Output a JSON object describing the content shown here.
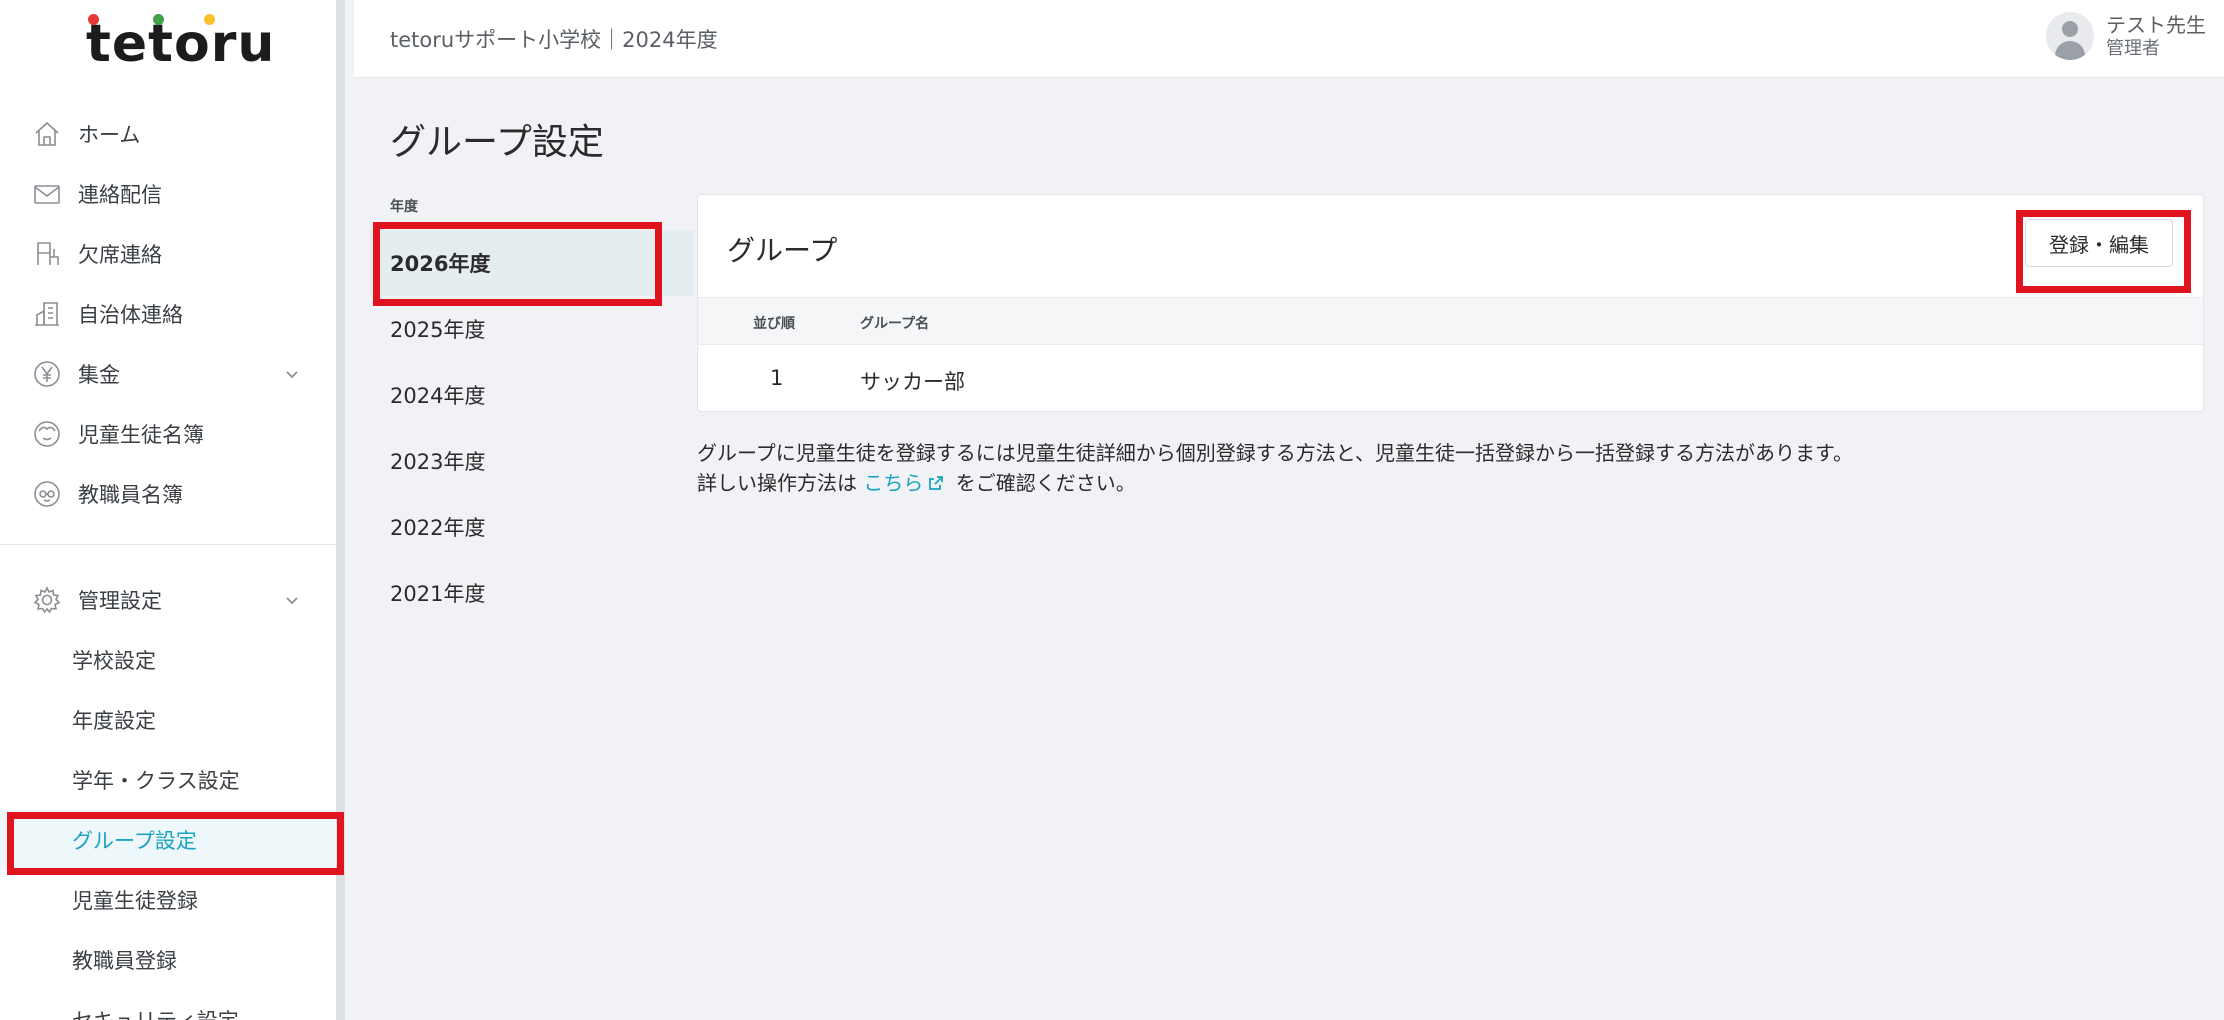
{
  "logo": {
    "text": "tetoru",
    "dot_colors": [
      "#e53935",
      "#43a047",
      "#fbc02d"
    ]
  },
  "header": {
    "title": "tetoruサポート小学校｜2024年度"
  },
  "user": {
    "name": "テスト先生",
    "role": "管理者"
  },
  "sidebar": {
    "items": [
      {
        "label": "ホーム",
        "icon": "home-icon"
      },
      {
        "label": "連絡配信",
        "icon": "mail-icon"
      },
      {
        "label": "欠席連絡",
        "icon": "desk-chair-icon"
      },
      {
        "label": "自治体連絡",
        "icon": "building-icon"
      },
      {
        "label": "集金",
        "icon": "yen-icon"
      },
      {
        "label": "児童生徒名簿",
        "icon": "child-face-icon"
      },
      {
        "label": "教職員名簿",
        "icon": "teacher-face-icon"
      }
    ],
    "admin": {
      "label": "管理設定",
      "icon": "gear-icon",
      "sub_items": [
        {
          "label": "学校設定"
        },
        {
          "label": "年度設定"
        },
        {
          "label": "学年・クラス設定"
        },
        {
          "label": "グループ設定",
          "active": true
        },
        {
          "label": "児童生徒登録"
        },
        {
          "label": "教職員登録"
        },
        {
          "label": "セキュリティ設定"
        }
      ]
    }
  },
  "main": {
    "title": "グループ設定",
    "year_heading": "年度",
    "years": [
      {
        "label": "2026年度",
        "active": true
      },
      {
        "label": "2025年度"
      },
      {
        "label": "2024年度"
      },
      {
        "label": "2023年度"
      },
      {
        "label": "2022年度"
      },
      {
        "label": "2021年度"
      }
    ],
    "panel": {
      "title": "グループ",
      "edit_button": "登録・編集",
      "columns": [
        "並び順",
        "グループ名"
      ],
      "rows": [
        {
          "order": "1",
          "name": "サッカー部"
        }
      ]
    },
    "note": {
      "line1": "グループに児童生徒を登録するには児童生徒詳細から個別登録する方法と、児童生徒一括登録から一括登録する方法があります。",
      "line2_prefix": "詳しい操作方法は",
      "link_text": "こちら",
      "line2_suffix": "をご確認ください。"
    }
  },
  "colors": {
    "accent": "#1aa3c1",
    "highlight_box": "#e0141e",
    "active_bg": "#eef8fa"
  }
}
